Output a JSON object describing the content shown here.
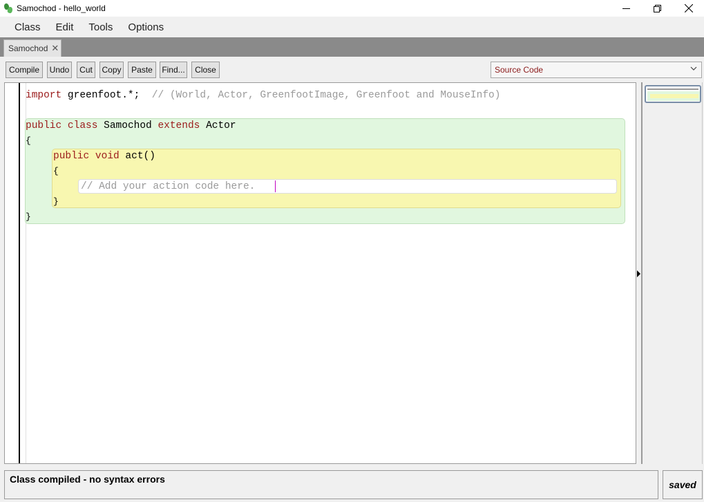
{
  "window": {
    "title": "Samochod - hello_world",
    "minimize_icon": "minimize-icon",
    "restore_icon": "restore-icon",
    "close_icon": "close-icon"
  },
  "menu": {
    "items": [
      "Class",
      "Edit",
      "Tools",
      "Options"
    ]
  },
  "tabs": [
    {
      "label": "Samochod",
      "close_icon": "close-icon"
    }
  ],
  "toolbar": {
    "compile": "Compile",
    "undo": "Undo",
    "cut": "Cut",
    "copy": "Copy",
    "paste": "Paste",
    "find": "Find...",
    "close": "Close",
    "view_select": "Source Code"
  },
  "code": {
    "line1_kw": "import",
    "line1_rest": " greenfoot.*;  ",
    "line1_comment": "// (World, Actor, GreenfootImage, Greenfoot and MouseInfo)",
    "line3_kw1": "public",
    "line3_kw2": "class",
    "line3_name": " Samochod ",
    "line3_kw3": "extends",
    "line3_super": " Actor",
    "line4": "{",
    "line5_kw1": "public",
    "line5_kw2": "void",
    "line5_rest": " act()",
    "line6": "{",
    "line7_comment": "// Add your action code here.",
    "line8": "}",
    "line9": "}"
  },
  "status": {
    "message": "Class compiled - no syntax errors",
    "saved": "saved"
  },
  "colors": {
    "keyword": "#9b1b1b",
    "comment": "#9a9a9a",
    "class_scope": "#e1f7df",
    "method_scope": "#f8f7b0"
  }
}
